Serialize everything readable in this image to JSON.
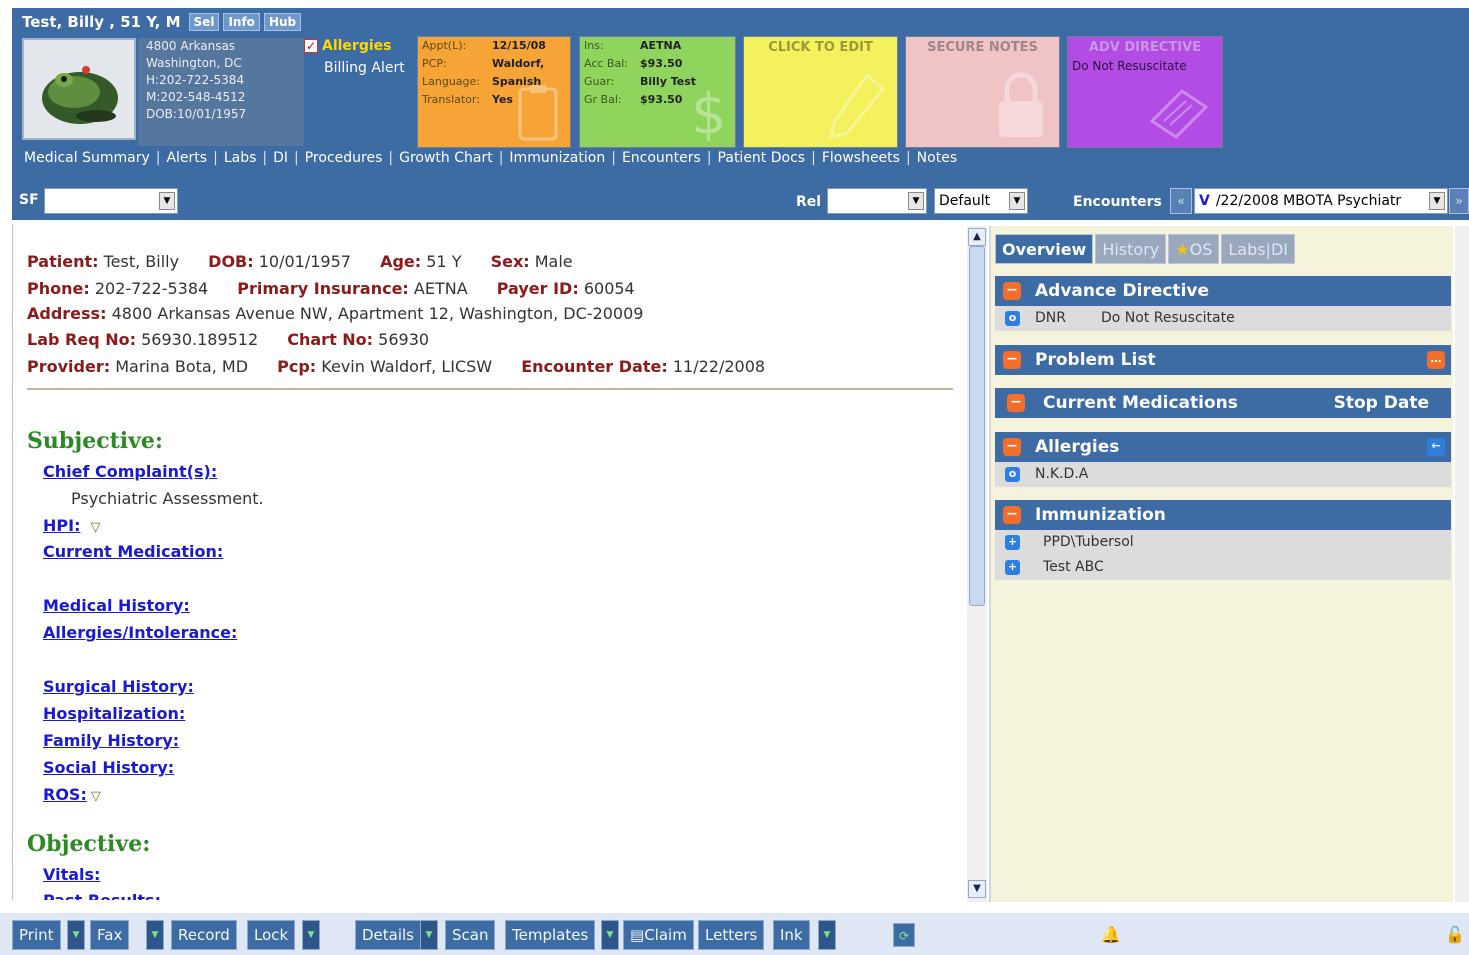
{
  "header": {
    "patient_title": "Test, Billy , 51 Y, M",
    "pills": [
      "Sel",
      "Info",
      "Hub"
    ],
    "contact": [
      "4800 Arkansas",
      "Washington, DC",
      "H:202-722-5384",
      "M:202-548-4512",
      "DOB:10/01/1957"
    ],
    "allergies_label": "Allergies",
    "billing_alert": "Billing Alert",
    "appt_card": {
      "rows": [
        {
          "k": "Appt(L):",
          "v": "12/15/08"
        },
        {
          "k": "PCP:",
          "v": "Waldorf,"
        },
        {
          "k": "Language:",
          "v": "Spanish"
        },
        {
          "k": "Translator:",
          "v": "Yes"
        }
      ]
    },
    "ins_card": {
      "rows": [
        {
          "k": "Ins:",
          "v": "AETNA"
        },
        {
          "k": "Acc Bal:",
          "v": "$93.50"
        },
        {
          "k": "Guar:",
          "v": "Billy Test"
        },
        {
          "k": "Gr Bal:",
          "v": "$93.50"
        }
      ]
    },
    "edit_card": "CLICK TO EDIT",
    "secure_card": "SECURE NOTES",
    "adv_card": {
      "title": "ADV DIRECTIVE",
      "text": "Do Not Resuscitate"
    },
    "nav": [
      "Medical Summary",
      "Alerts",
      "Labs",
      "DI",
      "Procedures",
      "Growth Chart",
      "Immunization",
      "Encounters",
      "Patient Docs",
      "Flowsheets",
      "Notes"
    ],
    "sf_label": "SF",
    "sf_value": "",
    "rel_label": "Rel",
    "rel_value": "",
    "default_value": "Default",
    "encounters_label": "Encounters",
    "encounter_value": "/22/2008 MBOTA Psychiatr",
    "encounter_prefix": "V"
  },
  "patient": {
    "labels": {
      "patient": "Patient:",
      "dob": "DOB:",
      "age": "Age:",
      "sex": "Sex:",
      "phone": "Phone:",
      "insurance": "Primary Insurance:",
      "payer": "Payer ID:",
      "address": "Address:",
      "labreq": "Lab Req No:",
      "chart": "Chart No:",
      "provider": "Provider:",
      "pcp": "Pcp:",
      "encdate": "Encounter Date:"
    },
    "name": "Test, Billy",
    "dob": "10/01/1957",
    "age": "51 Y",
    "sex": "Male",
    "phone": "202-722-5384",
    "insurance": "AETNA",
    "payer_id": "60054",
    "address": "4800 Arkansas Avenue NW, Apartment 12, Washington, DC-20009",
    "lab_req": "56930.189512",
    "chart_no": "56930",
    "provider": "Marina Bota, MD",
    "pcp": "Kevin Waldorf, LICSW",
    "encounter_date": "11/22/2008"
  },
  "note": {
    "subjective": "Subjective:",
    "chief_complaint": "Chief Complaint(s):",
    "chief_complaint_text": "Psychiatric Assessment.",
    "hpi": "HPI:",
    "current_medication": "Current Medication:",
    "medical_history": "Medical History:",
    "allergies": "Allergies/Intolerance:",
    "surgical_history": "Surgical History:",
    "hospitalization": "Hospitalization:",
    "family_history": "Family History:",
    "social_history": "Social History:",
    "ros": "ROS:",
    "objective": "Objective:",
    "vitals": "Vitals:",
    "past_results": "Past Results:"
  },
  "right": {
    "tabs": [
      "Overview",
      "History",
      "OS",
      "Labs|DI"
    ],
    "advance_directive": "Advance Directive",
    "adv_item": {
      "code": "DNR",
      "text": "Do Not Resuscitate"
    },
    "problem_list": "Problem List",
    "current_medications": "Current Medications",
    "stop_date": "Stop Date",
    "allergies": "Allergies",
    "allergy_item": "N.K.D.A",
    "immunization": "Immunization",
    "immunization_items": [
      "PPD\\Tubersol",
      "Test ABC"
    ]
  },
  "bottom": {
    "buttons": [
      "Print",
      "Fax",
      "Record",
      "Lock",
      "Details",
      "Scan",
      "Templates",
      "Claim",
      "Letters",
      "Ink"
    ]
  },
  "colors": {
    "header_blue": "#3d6ba3",
    "label_red": "#8b1a1a",
    "section_green": "#2c8a22",
    "link_blue": "#1a1ad0",
    "minus_orange": "#f46d2a"
  }
}
